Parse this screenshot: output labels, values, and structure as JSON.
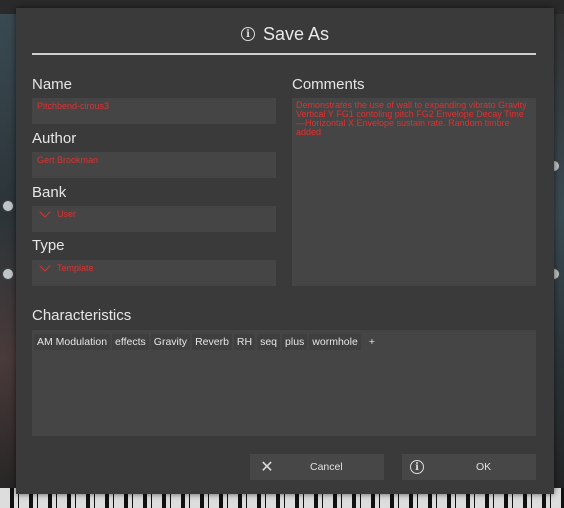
{
  "dialog": {
    "title": "Save As"
  },
  "fields": {
    "name_label": "Name",
    "name_value": "Pitchbend-cirous3",
    "author_label": "Author",
    "author_value": "Gert Brookman",
    "bank_label": "Bank",
    "bank_value": "User",
    "type_label": "Type",
    "type_value": "Template",
    "comments_label": "Comments",
    "comments_value": "Demonstrates the use of wall to expanding vibrato Gravity Vertical Y FG1 contoling pitch FG2 Envelope Decay Time—Horizontal X Envelope sustain rate. Random timbre added"
  },
  "characteristics": {
    "label": "Characteristics",
    "tags": [
      "AM Modulation",
      "effects",
      "Gravity",
      "Reverb",
      "RH",
      "seq",
      "plus",
      "wormhole"
    ],
    "add_label": "+"
  },
  "buttons": {
    "cancel_label": "Cancel",
    "ok_label": "OK"
  },
  "colors": {
    "dialog_bg": "#3a3a3a",
    "field_bg": "#454545",
    "value_text": "#e03030",
    "label_text": "#e6e6e6"
  },
  "icons": {
    "title_icon": "info-icon",
    "cancel_icon": "close-icon",
    "ok_icon": "info-icon",
    "dropdown_icon": "chevron-down-icon"
  }
}
